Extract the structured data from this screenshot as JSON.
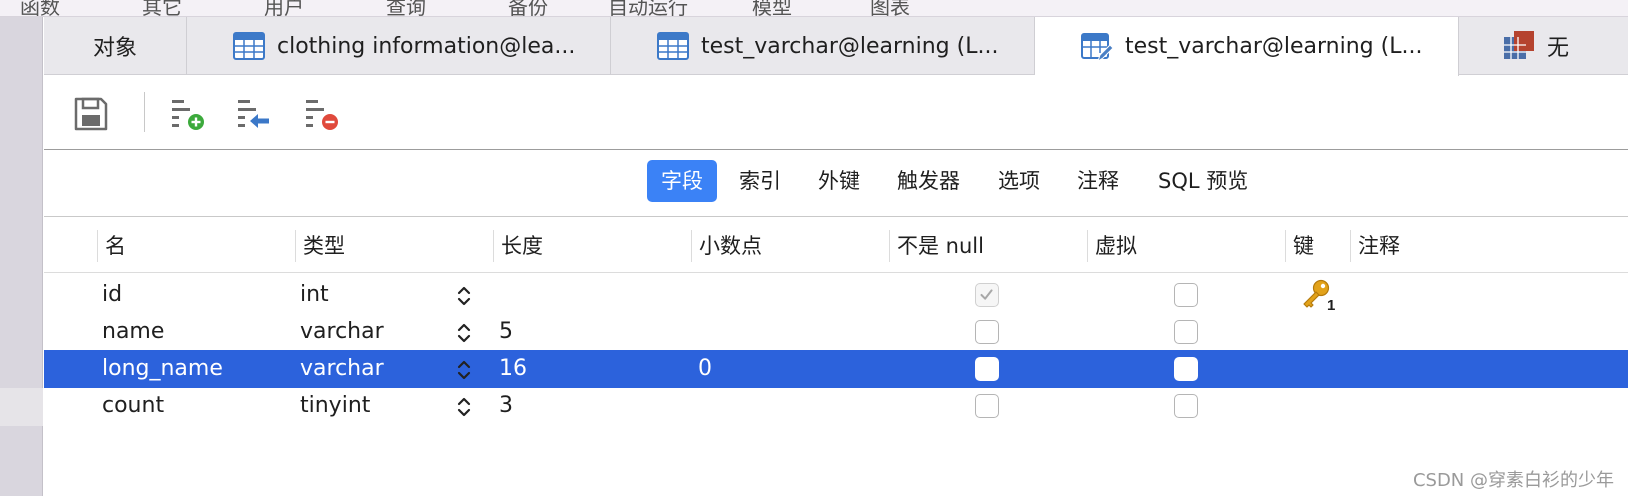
{
  "menu": [
    "函数",
    "其它",
    "用户",
    "查询",
    "备份",
    "自动运行",
    "模型",
    "图表"
  ],
  "tabs": [
    {
      "label": "对象",
      "icon": "none"
    },
    {
      "label": "clothing information@lea...",
      "icon": "table-icon"
    },
    {
      "label": "test_varchar@learning (L...",
      "icon": "table-icon"
    },
    {
      "label": "test_varchar@learning (L...",
      "icon": "table-design-icon",
      "active": true
    },
    {
      "label": "无",
      "icon": "table-red-icon"
    }
  ],
  "toolbar": {
    "save_icon": "save-icon",
    "add_field_icon": "add-field-icon",
    "insert_field_icon": "insert-field-icon",
    "delete_field_icon": "delete-field-icon"
  },
  "segments": [
    {
      "label": "字段",
      "active": true
    },
    {
      "label": "索引"
    },
    {
      "label": "外键"
    },
    {
      "label": "触发器"
    },
    {
      "label": "选项"
    },
    {
      "label": "注释"
    },
    {
      "label": "SQL 预览"
    }
  ],
  "columns": [
    "名",
    "类型",
    "长度",
    "小数点",
    "不是 null",
    "虚拟",
    "键",
    "注释"
  ],
  "rows": [
    {
      "name": "id",
      "type": "int",
      "length": "",
      "decimals": "",
      "not_null": true,
      "virtual": false,
      "key": "1",
      "selected": false
    },
    {
      "name": "name",
      "type": "varchar",
      "length": "5",
      "decimals": "",
      "not_null": false,
      "virtual": false,
      "key": "",
      "selected": false
    },
    {
      "name": "long_name",
      "type": "varchar",
      "length": "16",
      "decimals": "0",
      "not_null": false,
      "virtual": false,
      "key": "",
      "selected": true
    },
    {
      "name": "count",
      "type": "tinyint",
      "length": "3",
      "decimals": "",
      "not_null": false,
      "virtual": false,
      "key": "",
      "selected": false
    }
  ],
  "watermark": "CSDN @穿素白衫的少年",
  "colors": {
    "accent": "#3b82f6",
    "selection": "#2c62dc",
    "key": "#e2a21a"
  }
}
